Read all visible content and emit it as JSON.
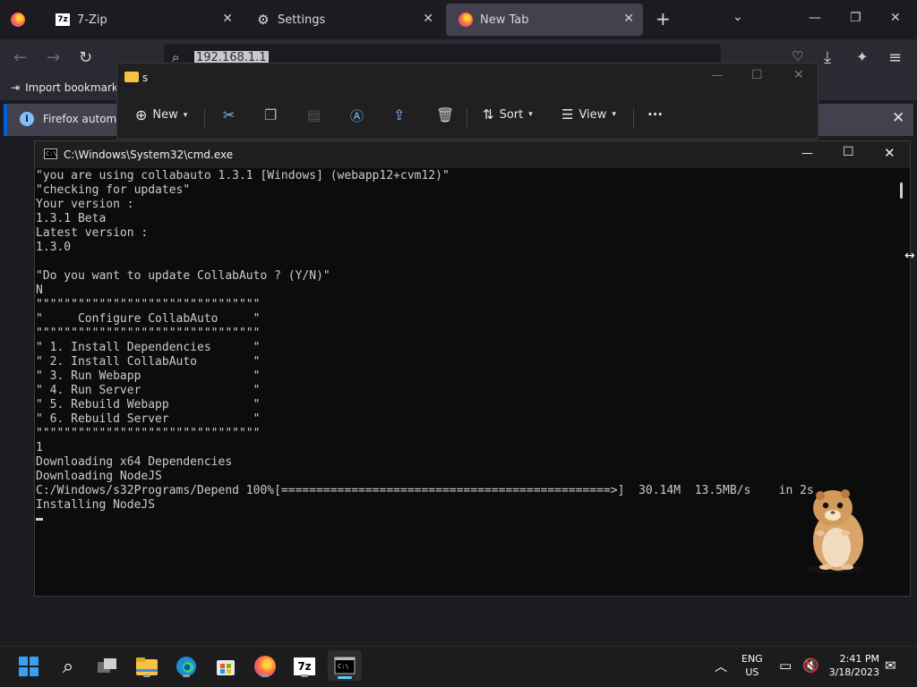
{
  "firefox": {
    "tabs": [
      {
        "label": "7-Zip"
      },
      {
        "label": "Settings"
      },
      {
        "label": "New Tab"
      }
    ],
    "url": "192.168.1.1",
    "bookmarks_item": "Import bookmarks",
    "infobar_text": "Firefox automati"
  },
  "explorer": {
    "title": "s",
    "toolbar": {
      "new_label": "New",
      "sort_label": "Sort",
      "view_label": "View",
      "more_label": "···"
    }
  },
  "cmd": {
    "title": "C:\\Windows\\System32\\cmd.exe",
    "lines": [
      "\"you are using collabauto 1.3.1 [Windows] (webapp12+cvm12)\"",
      "\"checking for updates\"",
      "Your version :",
      "1.3.1 Beta",
      "Latest version :",
      "1.3.0",
      "",
      "\"Do you want to update CollabAuto ? (Y/N)\"",
      "N",
      "\"\"\"\"\"\"\"\"\"\"\"\"\"\"\"\"\"\"\"\"\"\"\"\"\"\"\"\"\"\"\"\"",
      "\"     Configure CollabAuto     \"",
      "\"\"\"\"\"\"\"\"\"\"\"\"\"\"\"\"\"\"\"\"\"\"\"\"\"\"\"\"\"\"\"\"",
      "\" 1. Install Dependencies      \"",
      "\" 2. Install CollabAuto        \"",
      "\" 3. Run Webapp                \"",
      "\" 4. Run Server                \"",
      "\" 5. Rebuild Webapp            \"",
      "\" 6. Rebuild Server            \"",
      "\"\"\"\"\"\"\"\"\"\"\"\"\"\"\"\"\"\"\"\"\"\"\"\"\"\"\"\"\"\"\"\"",
      "1",
      "Downloading x64 Dependencies",
      "Downloading NodeJS",
      "C:/Windows/s32Programs/Depend 100%[===============================================>]  30.14M  13.5MB/s    in 2s",
      "Installing NodeJS"
    ]
  },
  "taskbar": {
    "lang_top": "ENG",
    "lang_bottom": "US",
    "time": "2:41 PM",
    "date": "3/18/2023"
  }
}
